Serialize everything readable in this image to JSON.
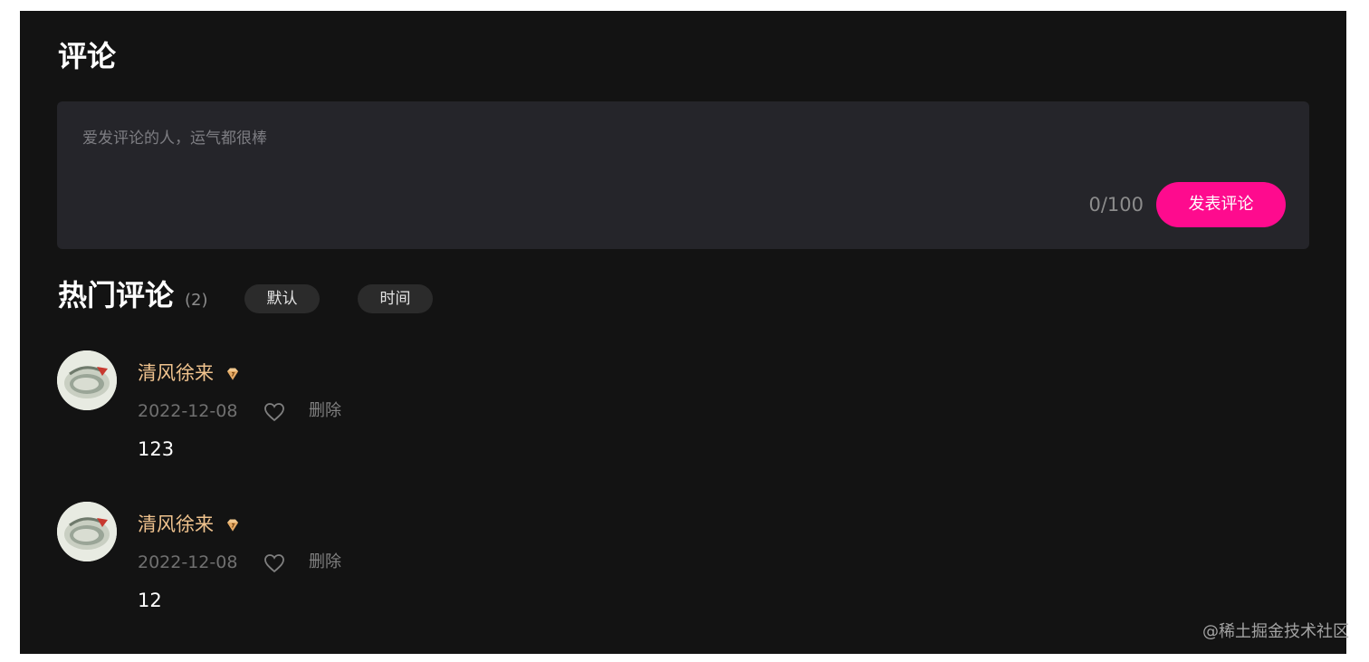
{
  "title": "评论",
  "composer": {
    "placeholder": "爱发评论的人，运气都很棒",
    "char_count": "0/100",
    "submit_label": "发表评论"
  },
  "hot": {
    "title": "热门评论",
    "count": "(2)",
    "tabs": [
      {
        "label": "默认"
      },
      {
        "label": "时间"
      }
    ]
  },
  "comments": [
    {
      "username": "清风徐来",
      "badge_icon": "diamond-badge-icon",
      "date": "2022-12-08",
      "like_icon": "heart-icon",
      "delete_label": "删除",
      "content": "123"
    },
    {
      "username": "清风徐来",
      "badge_icon": "diamond-badge-icon",
      "date": "2022-12-08",
      "like_icon": "heart-icon",
      "delete_label": "删除",
      "content": "12"
    }
  ],
  "watermark": "@稀土掘金技术社区",
  "colors": {
    "background": "#131313",
    "composer_bg": "#25252a",
    "accent": "#fe0b8e",
    "username": "#f0c38e"
  }
}
